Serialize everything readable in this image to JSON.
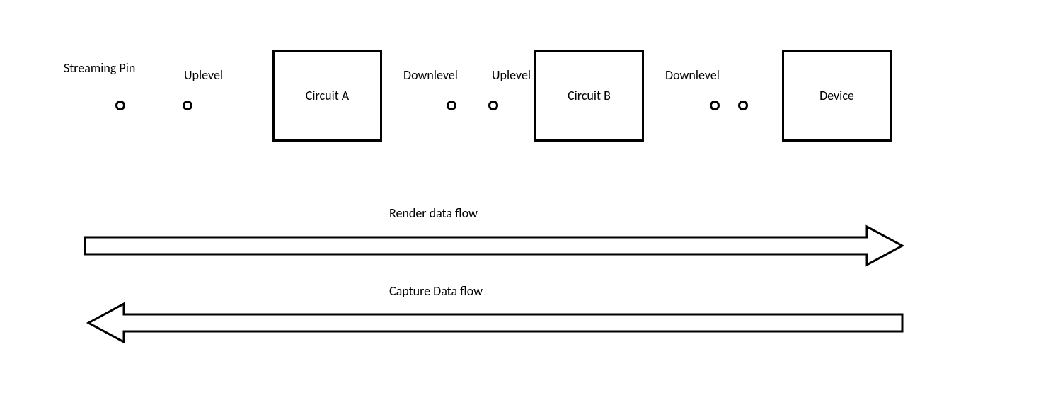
{
  "labels": {
    "streaming_pin": "Streaming Pin",
    "uplevel_1": "Uplevel",
    "circuit_a": "Circuit A",
    "downlevel_1": "Downlevel",
    "uplevel_2": "Uplevel",
    "circuit_b": "Circuit B",
    "downlevel_2": "Downlevel",
    "device": "Device",
    "render_flow": "Render data flow",
    "capture_flow": "Capture Data flow"
  }
}
